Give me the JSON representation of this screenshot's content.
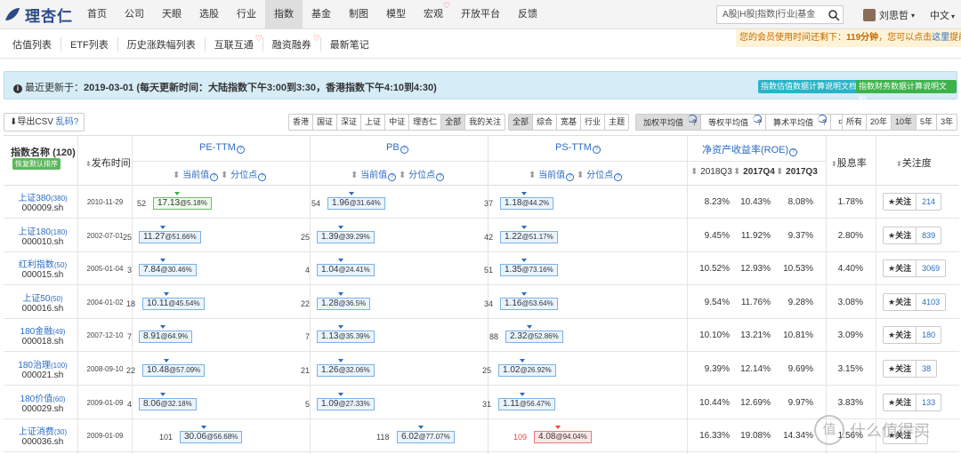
{
  "brand": {
    "name": "理杏仁"
  },
  "nav": [
    "首页",
    "公司",
    "天眼",
    "选股",
    "行业",
    "指数",
    "基金",
    "制图",
    "模型",
    "宏观",
    "开放平台",
    "反馈"
  ],
  "search": {
    "placeholder": "A股|H股|指数|行业|基金"
  },
  "user": {
    "name": "刘思哲",
    "lang": "中文"
  },
  "subnav": [
    "估值列表",
    "ETF列表",
    "历史涨跌幅列表",
    "互联互通",
    "融资融券",
    "最新笔记"
  ],
  "member": {
    "prefix": "您的会员使用时间还剩下：",
    "time": "119分钟",
    "mid": "，您可以点击",
    "link": "这里",
    "suffix": "提前"
  },
  "info": {
    "label": "最近更新于：",
    "date": "2019-03-01",
    "note": "(每天更新时间：大陆指数下午3:00到3:30，香港指数下午4:10到4:30)",
    "doc1": "指数估值数据计算说明文档",
    "doc2": "指数财务数据计算说明文档"
  },
  "toolbar": {
    "export": "导出CSV",
    "garbled": "乱码?",
    "markets": [
      "香港",
      "国证",
      "深证",
      "上证",
      "中证",
      "理杏仁",
      "全部",
      "我的关注"
    ],
    "categories": [
      "全部",
      "综合",
      "宽基",
      "行业",
      "主题"
    ],
    "weights": [
      "加权平均值",
      "等权平均值",
      "算术平均值",
      "中位数"
    ],
    "periods": [
      "所有",
      "20年",
      "10年",
      "5年",
      "3年"
    ]
  },
  "table": {
    "name_header": "指数名称",
    "count": "(120)",
    "reset": "恢复默认排序",
    "date_header": "发布时间",
    "pe": "PE-TTM",
    "pb": "PB",
    "ps": "PS-TTM",
    "roe": "净资产收益率(ROE)",
    "dividend": "股息率",
    "attention": "关注度",
    "current": "当前值",
    "percentile": "分位点",
    "q1": "2018Q3",
    "q2": "2017Q4",
    "q3": "2017Q3",
    "follow": "关注"
  },
  "rows": [
    {
      "name": "上证380",
      "num": "(380)",
      "code": "000009.sh",
      "date": "2010-11-29",
      "pe_rank": "52",
      "pe": "17.13",
      "pe_pct": "@5.18%",
      "pb_rank": "54",
      "pb": "1.96",
      "pb_pct": "@31.64%",
      "ps_rank": "37",
      "ps": "1.18",
      "ps_pct": "@44.2%",
      "r1": "8.23%",
      "r2": "10.43%",
      "r3": "8.08%",
      "div": "1.78%",
      "att": "214"
    },
    {
      "name": "上证180",
      "num": "(180)",
      "code": "000010.sh",
      "date": "2002-07-01",
      "pe_rank": "25",
      "pe": "11.27",
      "pe_pct": "@51.66%",
      "pb_rank": "25",
      "pb": "1.39",
      "pb_pct": "@39.29%",
      "ps_rank": "42",
      "ps": "1.22",
      "ps_pct": "@51.17%",
      "r1": "9.45%",
      "r2": "11.92%",
      "r3": "9.37%",
      "div": "2.80%",
      "att": "839"
    },
    {
      "name": "红利指数",
      "num": "(50)",
      "code": "000015.sh",
      "date": "2005-01-04",
      "pe_rank": "3",
      "pe": "7.84",
      "pe_pct": "@30.46%",
      "pb_rank": "4",
      "pb": "1.04",
      "pb_pct": "@24.41%",
      "ps_rank": "51",
      "ps": "1.35",
      "ps_pct": "@73.16%",
      "r1": "10.52%",
      "r2": "12.93%",
      "r3": "10.53%",
      "div": "4.40%",
      "att": "3069"
    },
    {
      "name": "上证50",
      "num": "(50)",
      "code": "000016.sh",
      "date": "2004-01-02",
      "pe_rank": "18",
      "pe": "10.11",
      "pe_pct": "@45.54%",
      "pb_rank": "22",
      "pb": "1.28",
      "pb_pct": "@36.5%",
      "ps_rank": "34",
      "ps": "1.16",
      "ps_pct": "@53.64%",
      "r1": "9.54%",
      "r2": "11.76%",
      "r3": "9.28%",
      "div": "3.08%",
      "att": "4103"
    },
    {
      "name": "180金融",
      "num": "(49)",
      "code": "000018.sh",
      "date": "2007-12-10",
      "pe_rank": "7",
      "pe": "8.91",
      "pe_pct": "@64.9%",
      "pb_rank": "7",
      "pb": "1.13",
      "pb_pct": "@35.39%",
      "ps_rank": "88",
      "ps": "2.32",
      "ps_pct": "@52.86%",
      "r1": "10.10%",
      "r2": "13.21%",
      "r3": "10.81%",
      "div": "3.09%",
      "att": "180"
    },
    {
      "name": "180治理",
      "num": "(100)",
      "code": "000021.sh",
      "date": "2008-09-10",
      "pe_rank": "22",
      "pe": "10.48",
      "pe_pct": "@57.09%",
      "pb_rank": "21",
      "pb": "1.26",
      "pb_pct": "@32.06%",
      "ps_rank": "25",
      "ps": "1.02",
      "ps_pct": "@26.92%",
      "r1": "9.39%",
      "r2": "12.14%",
      "r3": "9.69%",
      "div": "3.15%",
      "att": "38"
    },
    {
      "name": "180价值",
      "num": "(60)",
      "code": "000029.sh",
      "date": "2009-01-09",
      "pe_rank": "4",
      "pe": "8.06",
      "pe_pct": "@32.18%",
      "pb_rank": "5",
      "pb": "1.09",
      "pb_pct": "@27.33%",
      "ps_rank": "31",
      "ps": "1.11",
      "ps_pct": "@56.47%",
      "r1": "10.44%",
      "r2": "12.69%",
      "r3": "9.97%",
      "div": "3.83%",
      "att": "133"
    },
    {
      "name": "上证消费",
      "num": "(30)",
      "code": "000036.sh",
      "date": "2009-01-09",
      "pe_rank": "101",
      "pe": "30.06",
      "pe_pct": "@56.68%",
      "pb_rank": "118",
      "pb": "6.02",
      "pb_pct": "@77.07%",
      "ps_rank": "109",
      "ps": "4.08",
      "ps_pct": "@94.04%",
      "r1": "16.33%",
      "r2": "19.08%",
      "r3": "14.34%",
      "div": "1.56%",
      "att": ""
    }
  ],
  "watermark": {
    "icon": "值",
    "text": "什么值得买"
  },
  "colors": {
    "brand": "#2a4a86",
    "link": "#2b6cc4",
    "info_bg": "#d6ecf7",
    "low": "#3cb34a",
    "high": "#e44"
  }
}
